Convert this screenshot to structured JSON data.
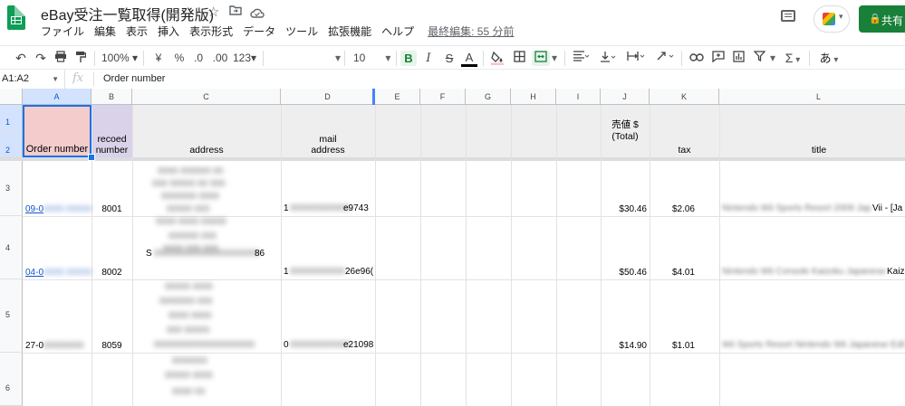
{
  "header": {
    "title": "eBay受注一覧取得(開発版)",
    "icons": [
      "star-icon",
      "folder-move-icon",
      "cloud-status-icon"
    ],
    "menu": [
      "ファイル",
      "編集",
      "表示",
      "挿入",
      "表示形式",
      "データ",
      "ツール",
      "拡張機能",
      "ヘルプ"
    ],
    "last_edit": "最終編集: 55 分前",
    "share_label": "共有"
  },
  "toolbar": {
    "zoom": "100%",
    "currency": "¥",
    "percent": "%",
    "dec_decrease": ".0",
    "dec_increase": ".00",
    "format_more": "123",
    "font_size": "10",
    "bold": "B",
    "italic": "I",
    "strike": "S",
    "text_color": "A",
    "input_tools": "あ"
  },
  "formula_bar": {
    "name_box": "A1:A2",
    "fx": "fx",
    "content": "Order number"
  },
  "grid": {
    "columns": [
      "A",
      "B",
      "C",
      "D",
      "E",
      "F",
      "G",
      "H",
      "I",
      "J",
      "K",
      "L"
    ],
    "rows": [
      "1",
      "2",
      "3",
      "4",
      "5",
      "6"
    ],
    "headers": {
      "a": "Order number",
      "b_line1": "recoed",
      "b_line2": "number",
      "c": "address",
      "d_line1": "mail",
      "d_line2": "address",
      "j_line1": "売値 $",
      "j_line2": "(Total)",
      "k": "tax",
      "l": "title"
    },
    "data_rows": [
      {
        "order_prefix": "09-0",
        "order_blur": "0000-00000",
        "record": "8001",
        "mail_prefix": "1",
        "mail_blur": "000000000000",
        "mail_suffix": "e9743",
        "price": "$30.46",
        "tax": "$2.06",
        "title_blur": "Nintendo Wii Sports Resort 2009 Japanese",
        "title_suffix": "Vii - [Ja"
      },
      {
        "order_prefix": "04-0",
        "order_blur": "0000-00000",
        "record": "8002",
        "mail_prefix": "1",
        "mail_blur": "00000000000",
        "mail_suffix": "26e96(",
        "price": "$50.46",
        "tax": "$4.01",
        "title_blur": "Nintendo Wii Console Kaizoku Japanese Edition",
        "title_suffix": "Kaiz"
      },
      {
        "order_prefix": "27-0",
        "order_blur": "00000000",
        "record": "8059",
        "mail_prefix": "0",
        "mail_blur": "000000000000",
        "mail_suffix": "e21098",
        "price": "$14.90",
        "tax": "$1.01",
        "title_blur": "Wii Sports Resort Nintendo Wii Japanese Edition"
      }
    ],
    "address_blur_lines": [
      "0000 000000 00",
      "000 00000 00 000",
      "0000000 0000",
      "00000 000",
      "0000 0000 00000",
      "000000 000",
      "0000 000 000",
      "00000000000000000000",
      "00000 0000",
      "0000000 000",
      "0000 0000",
      "000 00000",
      "0000000",
      "00000 0000",
      "0000 00"
    ],
    "address_visible_prefix": "S",
    "address_visible_suffix": "86"
  }
}
